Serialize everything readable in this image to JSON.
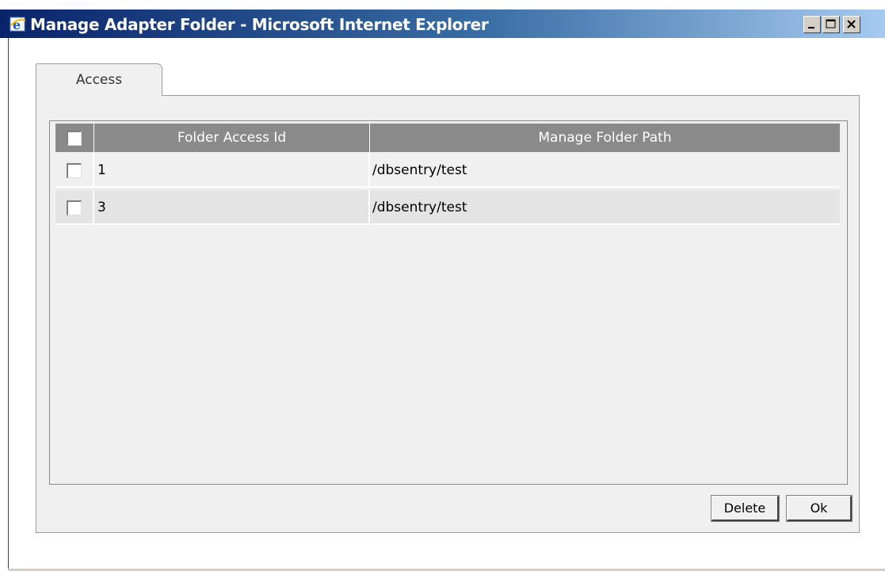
{
  "window": {
    "title": "Manage Adapter Folder - Microsoft Internet Explorer"
  },
  "tabs": [
    {
      "label": "Access",
      "selected": true
    }
  ],
  "table": {
    "columns": [
      "",
      "Folder Access Id",
      "Manage Folder Path"
    ],
    "rows": [
      {
        "checked": false,
        "id": "1",
        "path": "/dbsentry/test"
      },
      {
        "checked": false,
        "id": "3",
        "path": "/dbsentry/test"
      }
    ]
  },
  "buttons": {
    "delete": "Delete",
    "ok": "Ok"
  },
  "icons": {
    "app": "ie-icon",
    "minimize": "minimize-icon",
    "maximize": "maximize-icon",
    "close": "close-icon"
  },
  "colors": {
    "header_bg": "#8a8a8a",
    "title_gradient_start": "#0a246a",
    "title_gradient_end": "#a6caf0"
  }
}
